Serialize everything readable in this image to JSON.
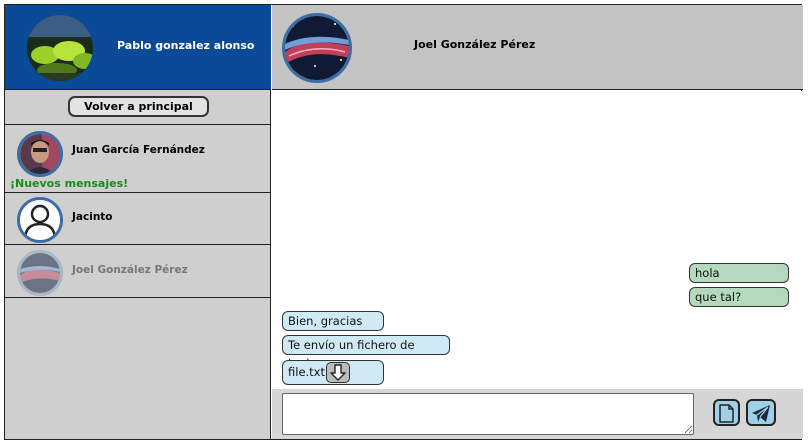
{
  "current_user": {
    "name": "Pablo gonzalez alonso"
  },
  "back_button": {
    "label": "Volver a principal"
  },
  "contacts": [
    {
      "name": "Juan García Fernández",
      "notice": "¡Nuevos mensajes!"
    },
    {
      "name": "Jacinto"
    },
    {
      "name": "Joel González Pérez",
      "state": "selected"
    }
  ],
  "chat": {
    "contact_name": "Joel González Pérez",
    "messages": [
      {
        "from": "me",
        "text": "hola"
      },
      {
        "from": "me",
        "text": "que tal?"
      },
      {
        "from": "them",
        "text": "Bien, gracias"
      },
      {
        "from": "them",
        "text": "Te envío un fichero de texto."
      },
      {
        "from": "them",
        "text": "file.txt",
        "attachment": true
      }
    ],
    "composer": {
      "value": ""
    }
  },
  "colors": {
    "header_blue": "#0a4a97",
    "sidebar_gray": "#cfcfcf",
    "sent_bubble": "#b5d9bd",
    "received_bubble": "#cfeaf5",
    "new_messages_green": "#1a8a1a"
  },
  "icons": {
    "download": "download-arrow-icon",
    "file": "file-icon",
    "send": "paper-plane-icon"
  }
}
